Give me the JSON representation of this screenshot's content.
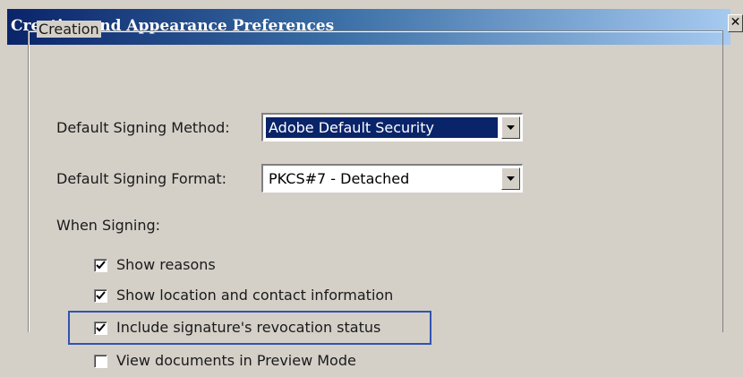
{
  "window": {
    "title": "Creation and Appearance Preferences",
    "close_glyph": "✕"
  },
  "creation_group": {
    "label": "Creation",
    "default_signing_method": {
      "label": "Default Signing Method:",
      "value": "Adobe Default Security"
    },
    "default_signing_format": {
      "label": "Default Signing Format:",
      "value": "PKCS#7 - Detached"
    },
    "when_signing": {
      "label": "When Signing:",
      "options": [
        {
          "label": "Show reasons",
          "checked": true
        },
        {
          "label": "Show location and contact information",
          "checked": true
        },
        {
          "label": "Include signature's revocation status",
          "checked": true
        },
        {
          "label": "View documents in Preview Mode",
          "checked": false
        }
      ]
    }
  },
  "colors": {
    "title_gradient_start": "#0a246a",
    "title_gradient_end": "#a6caf0",
    "dialog_face": "#d4d0c8",
    "selection": "#0a246a",
    "highlight_border": "#3153b0"
  },
  "icons": {
    "close": "close-icon",
    "dropdown": "chevron-down-icon",
    "check": "checkmark-icon"
  }
}
